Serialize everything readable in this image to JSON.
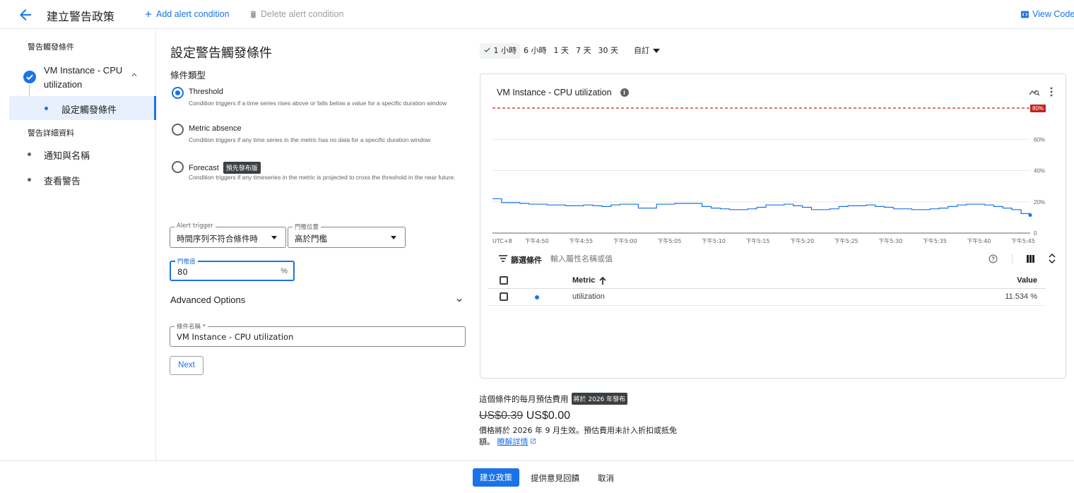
{
  "header": {
    "title": "建立警告政策",
    "add_condition": "Add alert condition",
    "delete_condition": "Delete alert condition",
    "view_code": "View Code"
  },
  "sidebar": {
    "section1": "警告觸發條件",
    "step_label": "VM Instance - CPU utilization",
    "sub_item": "設定觸發條件",
    "section2": "警告詳細資料",
    "items": [
      "通知與名稱",
      "查看警告"
    ]
  },
  "form": {
    "title": "設定警告觸發條件",
    "condition_type_label": "條件類型",
    "options": [
      {
        "title": "Threshold",
        "desc": "Condition triggers if a time series rises above or falls below a value for a specific duration window",
        "selected": true
      },
      {
        "title": "Metric absence",
        "desc": "Condition triggers if any time series in the metric has no data for a specific duration window",
        "selected": false
      },
      {
        "title": "Forecast",
        "badge": "預先發布版",
        "desc": "Condition triggers if any timeseries in the metric is projected to cross the threshold in the near future.",
        "selected": false
      }
    ],
    "alert_trigger": {
      "label": "Alert trigger",
      "value": "時間序列不符合條件時"
    },
    "threshold_position": {
      "label": "門檻位置",
      "value": "高於門檻"
    },
    "threshold_value": {
      "label": "門檻值",
      "value": "80",
      "unit": "%"
    },
    "advanced_options": "Advanced Options",
    "condition_name": {
      "label": "條件名稱 *",
      "value": "VM Instance - CPU utilization"
    },
    "next": "Next"
  },
  "time_range": {
    "options": [
      "1 小時",
      "6 小時",
      "1 天",
      "7 天",
      "30 天"
    ],
    "selected": "1 小時",
    "custom": "自訂"
  },
  "chart": {
    "title": "VM Instance - CPU utilization",
    "threshold_label": "80%",
    "colors": {
      "series": "#1a73e8",
      "threshold": "#c5221f"
    }
  },
  "chart_data": {
    "type": "line",
    "title": "VM Instance - CPU utilization",
    "threshold": 80,
    "ylim": [
      0,
      80
    ],
    "yticks": [
      "0",
      "20%",
      "40%",
      "60%"
    ],
    "xticks": [
      "UTC+8",
      "下午4:50",
      "下午4:55",
      "下午5:00",
      "下午5:05",
      "下午5:10",
      "下午5:15",
      "下午5:20",
      "下午5:25",
      "下午5:30",
      "下午5:35",
      "下午5:40",
      "下午5:45"
    ],
    "series": [
      {
        "name": "utilization",
        "x": [
          0,
          1,
          3,
          4,
          5,
          6,
          7,
          8,
          9,
          10,
          11,
          12,
          13,
          14,
          15,
          16,
          17,
          18,
          19,
          20,
          21,
          22,
          23,
          24,
          25,
          26,
          27,
          28,
          29,
          30,
          31,
          32,
          33,
          34,
          35,
          36,
          37,
          38,
          39,
          40,
          41,
          42,
          43,
          44,
          45,
          46,
          47,
          48,
          49,
          50,
          51,
          52,
          53,
          54,
          55,
          56,
          57,
          58,
          59
        ],
        "y": [
          22,
          19.5,
          19,
          18.5,
          18.5,
          18,
          18,
          17.5,
          17.5,
          18,
          17.5,
          17,
          18,
          18.5,
          18.5,
          16,
          16,
          18.5,
          18.5,
          19,
          19,
          19,
          17,
          16,
          15.5,
          15,
          15,
          15.5,
          16.5,
          18,
          18,
          18.5,
          17.5,
          16.5,
          15,
          15,
          15.5,
          17,
          17.5,
          17.5,
          18,
          17,
          16.5,
          15.5,
          15.5,
          15,
          15,
          15.5,
          16,
          17,
          18,
          18.5,
          18.5,
          18,
          17,
          16,
          15,
          12.5,
          11.5
        ]
      }
    ]
  },
  "filter": {
    "label": "篩選條件",
    "placeholder": "輸入屬性名稱或值"
  },
  "table": {
    "headers": {
      "metric": "Metric",
      "value": "Value"
    },
    "rows": [
      {
        "metric": "utilization",
        "value": "11.534  %"
      }
    ]
  },
  "cost": {
    "label": "這個條件的每月預估費用",
    "badge": "將於 2026 年發布",
    "old_price": "US$0.39",
    "new_price": "US$0.00",
    "note": "價格將於 2026 年 9 月生效。預估費用未計入折扣或抵免額。",
    "link": "瞭解詳情"
  },
  "footer": {
    "create": "建立政策",
    "feedback": "提供意見回饋",
    "cancel": "取消"
  }
}
